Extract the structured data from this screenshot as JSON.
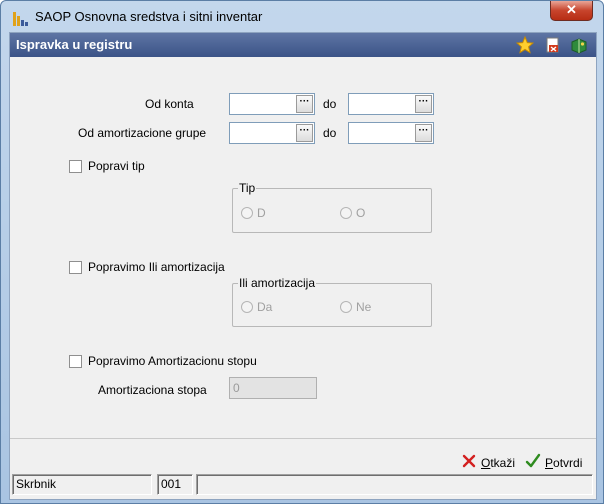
{
  "window": {
    "title": "SAOP Osnovna sredstva i sitni inventar",
    "close_glyph": "✕",
    "accent": "#3b5387"
  },
  "header": {
    "title": "Ispravka u registru",
    "icons": [
      "star-icon",
      "document-delete-icon",
      "book-icon"
    ]
  },
  "form": {
    "konto_label": "Od konta",
    "konto_from": "",
    "konto_to": "",
    "grupa_label": "Od amortizacione grupe",
    "grupa_from": "",
    "grupa_to": "",
    "do_label": "do",
    "dots": "···",
    "tip_checkbox": "Popravi tip",
    "tip_group": "Tip",
    "tip_options": [
      "D",
      "O"
    ],
    "ili_checkbox": "Popravimo Ili  amortizacija",
    "ili_group": "Ili amortizacija",
    "ili_options": [
      "Da",
      "Ne"
    ],
    "stopa_checkbox": "Popravimo  Amortizacionu stopu",
    "stopa_label": "Amortizaciona stopa",
    "stopa_value": "0"
  },
  "buttons": {
    "cancel": "Otkaži",
    "confirm": "Potvrdi"
  },
  "status": {
    "user": "Skrbnik",
    "code": "001",
    "extra": ""
  }
}
